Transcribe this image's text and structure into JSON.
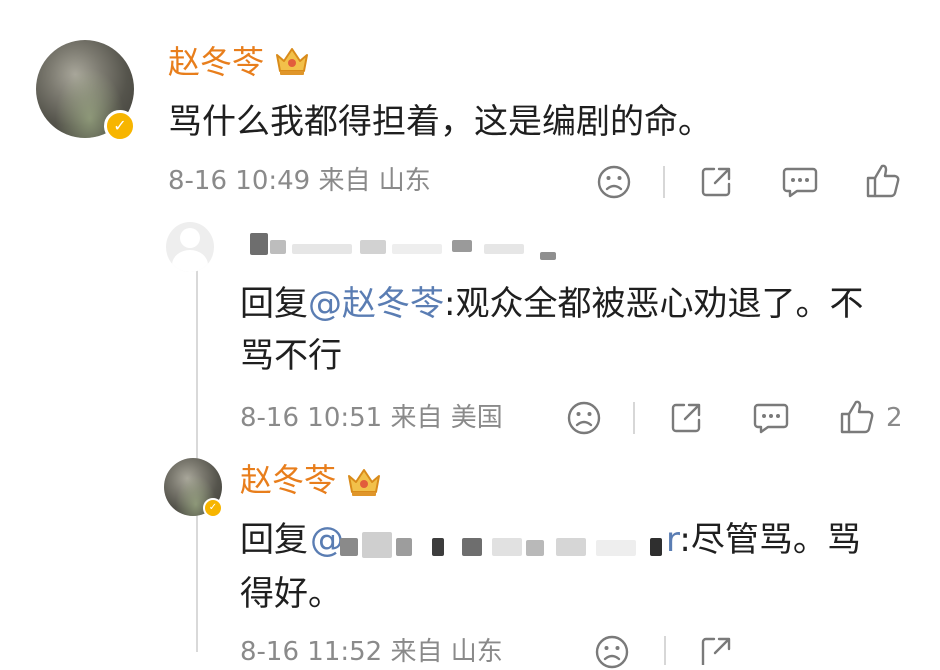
{
  "comment": {
    "author": "赵冬苓",
    "text": "骂什么我都得担着，这是编剧的命。",
    "meta": "8-16 10:49 来自 山东"
  },
  "reply1": {
    "prefix": "回复",
    "mention": "@赵冬苓",
    "text_line1": ":观众全都被恶心劝退了。不",
    "text_line2": "骂不行",
    "meta": "8-16 10:51 来自 美国",
    "like_count": "2"
  },
  "reply2": {
    "author": "赵冬苓",
    "prefix": "回复",
    "mention_start": "@",
    "mention_end": "r",
    "text_line1": ":尽管骂。骂",
    "text_line2": "得好。",
    "meta": "8-16 11:52 来自 山东"
  },
  "icons": {
    "dislike": "sad-face-icon",
    "share": "share-icon",
    "comment": "comment-icon",
    "like": "thumb-up-icon",
    "verified": "verified-badge-icon",
    "vip_crown": "crown-icon"
  },
  "colors": {
    "name": "#e87e1c",
    "mention": "#5a7db3",
    "meta": "#8a8a8a",
    "badge": "#f7b500"
  }
}
